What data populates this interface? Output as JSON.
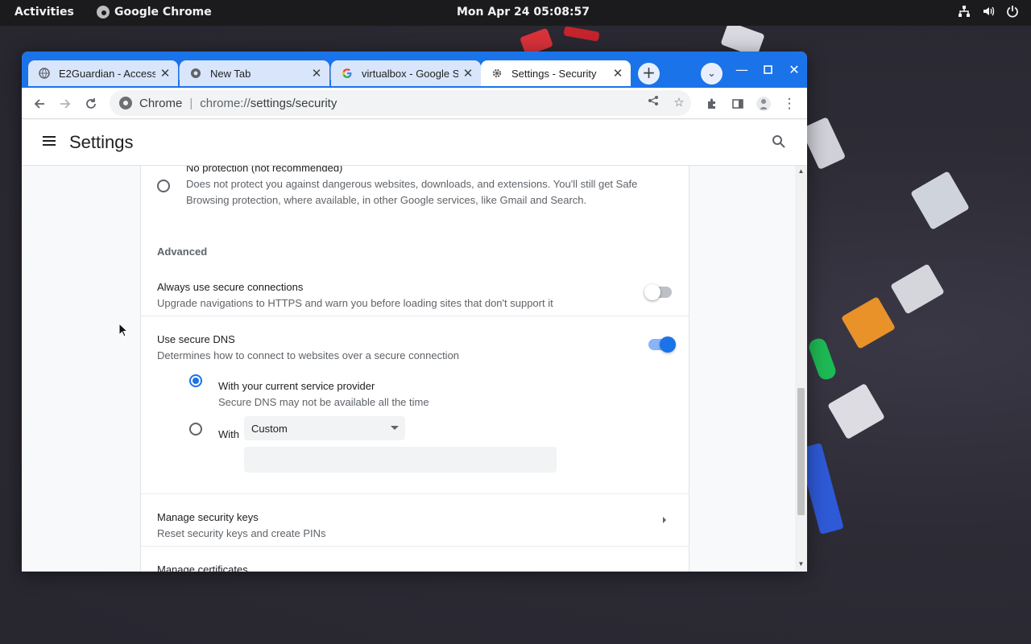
{
  "topbar": {
    "activities": "Activities",
    "app_name": "Google Chrome",
    "clock": "Mon Apr 24  05:08:57",
    "tray_icons": [
      "network-icon",
      "volume-icon",
      "power-icon"
    ]
  },
  "browser": {
    "tabs": [
      {
        "title": "E2Guardian - Access",
        "icon": "globe-icon",
        "active": false
      },
      {
        "title": "New Tab",
        "icon": "chrome-icon",
        "active": false
      },
      {
        "title": "virtualbox - Google S",
        "icon": "google-icon",
        "active": false
      },
      {
        "title": "Settings - Security",
        "icon": "gear-icon",
        "active": true
      }
    ],
    "omnibox": {
      "chip": "Chrome",
      "url_scheme": "chrome://",
      "url_path": "settings/security"
    },
    "accent_color": "#1a73e8"
  },
  "settings": {
    "title": "Settings",
    "no_protection": {
      "label": "No protection (not recommended)",
      "description_line1": "Does not protect you against dangerous websites, downloads, and extensions. You'll still get Safe",
      "description_line2": "Browsing protection, where available, in other Google services, like Gmail and Search.",
      "selected": false
    },
    "advanced_heading": "Advanced",
    "always_secure": {
      "label": "Always use secure connections",
      "description": "Upgrade navigations to HTTPS and warn you before loading sites that don't support it",
      "enabled": false
    },
    "secure_dns": {
      "label": "Use secure DNS",
      "description": "Determines how to connect to websites over a secure connection",
      "enabled": true,
      "option_current": {
        "label": "With your current service provider",
        "description": "Secure DNS may not be available all the time",
        "selected": true
      },
      "option_custom": {
        "label": "With",
        "selected": false,
        "provider": "Custom",
        "input_value": ""
      }
    },
    "security_keys": {
      "label": "Manage security keys",
      "description": "Reset security keys and create PINs"
    },
    "certificates": {
      "label": "Manage certificates"
    }
  }
}
